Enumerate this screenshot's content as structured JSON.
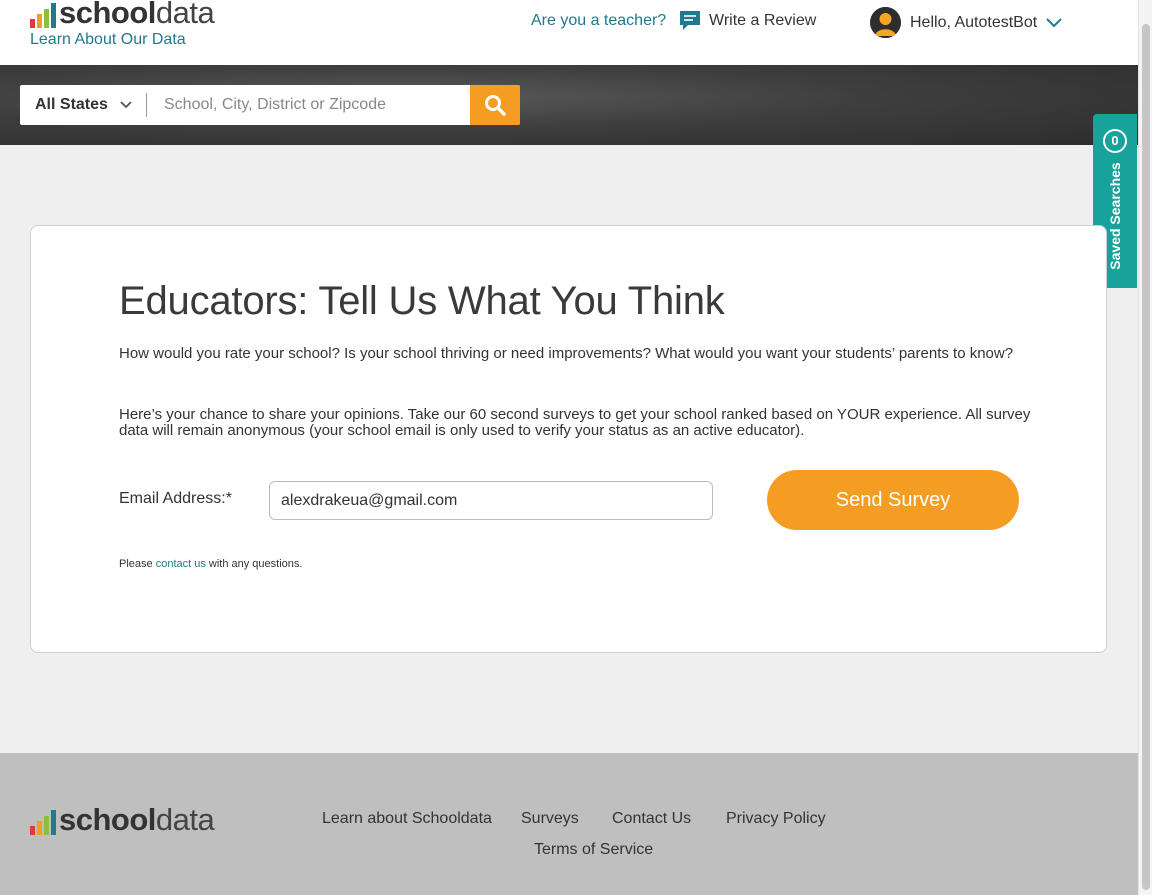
{
  "header": {
    "logo_bold": "school",
    "logo_light": "data",
    "learn_link": "Learn About Our Data",
    "teacher_link": "Are you a teacher?",
    "review_label": "Write a Review",
    "user_greeting": "Hello, AutotestBot"
  },
  "search": {
    "state_label": "All States",
    "placeholder": "School, City, District or Zipcode"
  },
  "saved_searches": {
    "count": "0",
    "label": "Saved Searches"
  },
  "main": {
    "title": "Educators: Tell Us What You Think",
    "paragraph1": "How would you rate your school? Is your school thriving or need improvements? What would you want your students’ parents to know?",
    "paragraph2": "Here’s your chance to share your opinions. Take our 60 second surveys to get your school ranked based on YOUR experience. All survey data will remain anonymous (your school email is only used to verify your status as an active educator).",
    "email_label": "Email Address:*",
    "email_value": "alexdrakeua@gmail.com",
    "send_label": "Send Survey",
    "note_before": "Please ",
    "note_link": "contact us",
    "note_after": " with any questions."
  },
  "footer": {
    "logo_bold": "school",
    "logo_light": "data",
    "links": {
      "learn": "Learn about Schooldata",
      "surveys": "Surveys",
      "contact": "Contact Us",
      "privacy": "Privacy Policy",
      "terms": "Terms of Service"
    }
  },
  "colors": {
    "accent_orange": "#f59d23",
    "teal": "#17a39c",
    "link": "#1e7a8c",
    "bar1": "#e03b3b",
    "bar2": "#f59d23",
    "bar3": "#8cbf3f",
    "bar4": "#1e7a8c"
  },
  "icons": {
    "search": "search-icon",
    "review": "speech-bubble-icon",
    "user": "avatar-icon",
    "dropdown": "chevron-down-icon"
  }
}
